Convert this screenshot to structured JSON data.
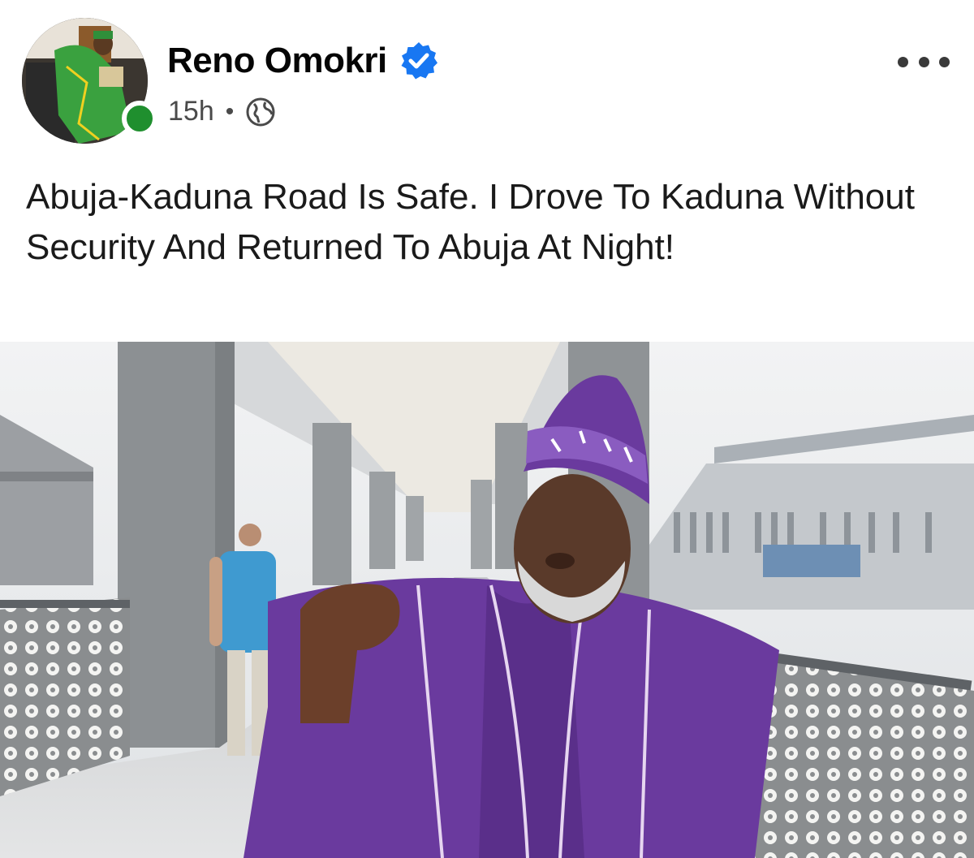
{
  "post": {
    "author_name": "Reno Omokri",
    "verified": true,
    "timestamp": "15h",
    "separator": "•",
    "audience_icon": "globe-icon",
    "more_icon": "more-options-icon",
    "text": "Abuja-Kaduna Road Is Safe. I Drove To Kaduna Without Security And Returned To Abuja At Night!",
    "avatar_icon": "profile-photo",
    "presence_color": "#1f8f2e",
    "verified_color": "#1877f2"
  },
  "photo": {
    "kind": "photo",
    "accent_color": "#6a3a9e"
  }
}
